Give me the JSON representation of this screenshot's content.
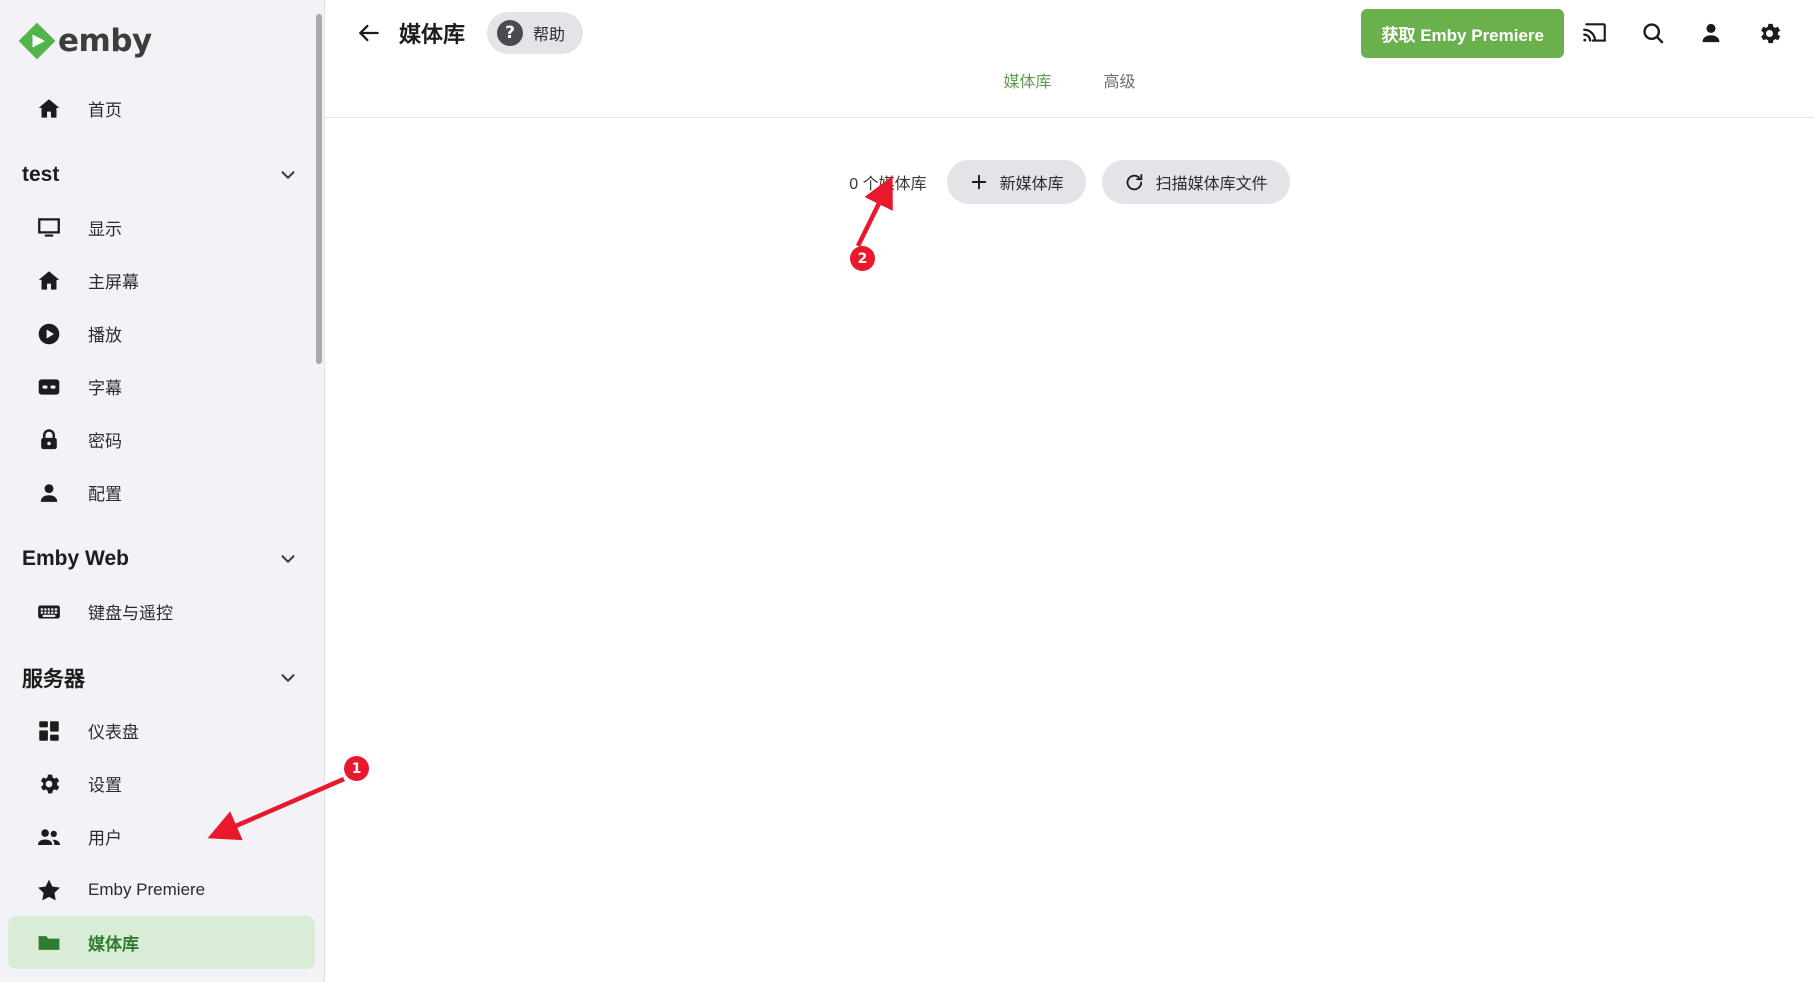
{
  "brand": {
    "name": "emby",
    "logo_icon": "emby-logo-icon",
    "accent_green": "#6ab04c",
    "active_green": "#2f7d32"
  },
  "sidebar": {
    "home": {
      "label": "首页",
      "icon": "home-icon"
    },
    "sections": [
      {
        "title": "test",
        "chevron_icon": "chevron-down-icon",
        "items": [
          {
            "label": "显示",
            "icon": "display-icon"
          },
          {
            "label": "主屏幕",
            "icon": "home-icon"
          },
          {
            "label": "播放",
            "icon": "play-circle-icon"
          },
          {
            "label": "字幕",
            "icon": "closed-caption-icon"
          },
          {
            "label": "密码",
            "icon": "lock-icon"
          },
          {
            "label": "配置",
            "icon": "person-icon"
          }
        ]
      },
      {
        "title": "Emby Web",
        "chevron_icon": "chevron-down-icon",
        "items": [
          {
            "label": "键盘与遥控",
            "icon": "keyboard-icon"
          }
        ]
      },
      {
        "title": "服务器",
        "chevron_icon": "chevron-down-icon",
        "items": [
          {
            "label": "仪表盘",
            "icon": "dashboard-icon"
          },
          {
            "label": "设置",
            "icon": "gear-icon"
          },
          {
            "label": "用户",
            "icon": "people-icon"
          },
          {
            "label": "Emby Premiere",
            "icon": "star-icon"
          },
          {
            "label": "媒体库",
            "icon": "folder-icon",
            "active": true
          }
        ]
      }
    ]
  },
  "topbar": {
    "back_icon": "arrow-left-icon",
    "title": "媒体库",
    "help": {
      "label": "帮助",
      "icon": "question-mark-icon"
    },
    "premiere_button": "获取 Emby Premiere",
    "icons": [
      {
        "name": "cast-icon"
      },
      {
        "name": "search-icon"
      },
      {
        "name": "person-icon"
      },
      {
        "name": "gear-icon"
      }
    ]
  },
  "tabs": [
    {
      "label": "媒体库",
      "active": true
    },
    {
      "label": "高级",
      "active": false
    }
  ],
  "library": {
    "count_text": "0 个媒体库",
    "add_button": {
      "label": "新媒体库",
      "icon": "plus-icon"
    },
    "scan_button": {
      "label": "扫描媒体库文件",
      "icon": "refresh-icon"
    }
  },
  "annotations": [
    {
      "number": "1",
      "color": "#e8192c"
    },
    {
      "number": "2",
      "color": "#e8192c"
    }
  ]
}
